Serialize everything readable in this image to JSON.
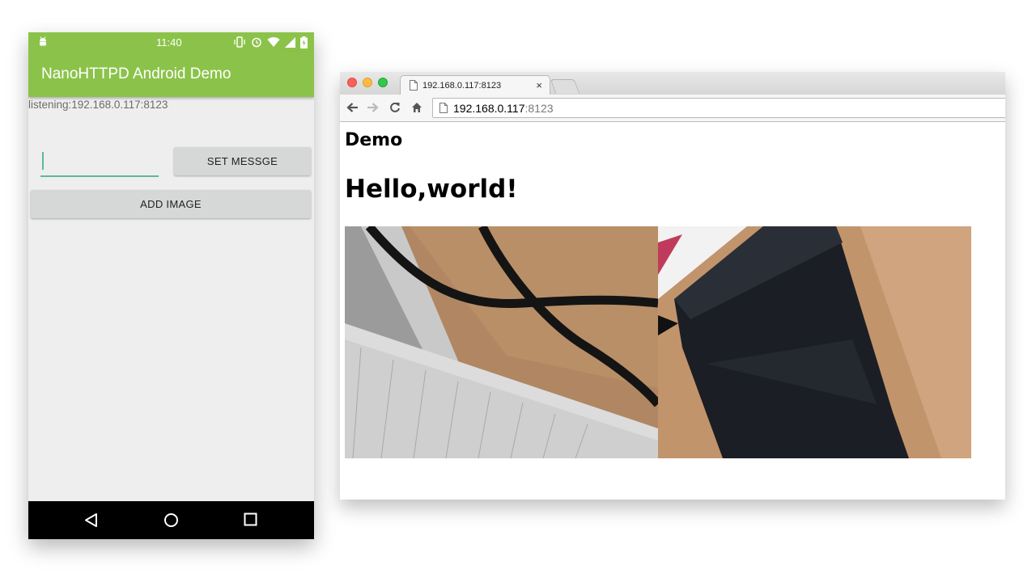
{
  "phone": {
    "status_bar": {
      "time": "11:40",
      "icons": [
        "android-icon",
        "vibrate-icon",
        "alarm-icon",
        "wifi-icon",
        "signal-icon",
        "battery-icon"
      ],
      "color": "#8bc34a"
    },
    "app_bar": {
      "title": "NanoHTTPD Android Demo",
      "color": "#8bc34a"
    },
    "listening_text": "listening:192.168.0.117:8123",
    "message_input": {
      "value": "",
      "placeholder": "",
      "accent": "#5fb89a"
    },
    "set_message_button": "SET MESSGE",
    "add_image_button": "ADD IMAGE",
    "nav_bar": {
      "icons": [
        "back-icon",
        "home-icon",
        "recents-icon"
      ]
    }
  },
  "browser": {
    "tab": {
      "title": "192.168.0.117:8123",
      "close": "×"
    },
    "toolbar": {
      "icons": [
        "back-arrow-icon",
        "forward-arrow-icon",
        "reload-icon",
        "home-icon"
      ]
    },
    "address": {
      "host": "192.168.0.117",
      "port": ":8123"
    },
    "page": {
      "heading": "Demo",
      "message": "Hello,world!",
      "images": [
        "photo-black-cord-on-desk",
        "photo-black-leather-pouch"
      ]
    }
  }
}
